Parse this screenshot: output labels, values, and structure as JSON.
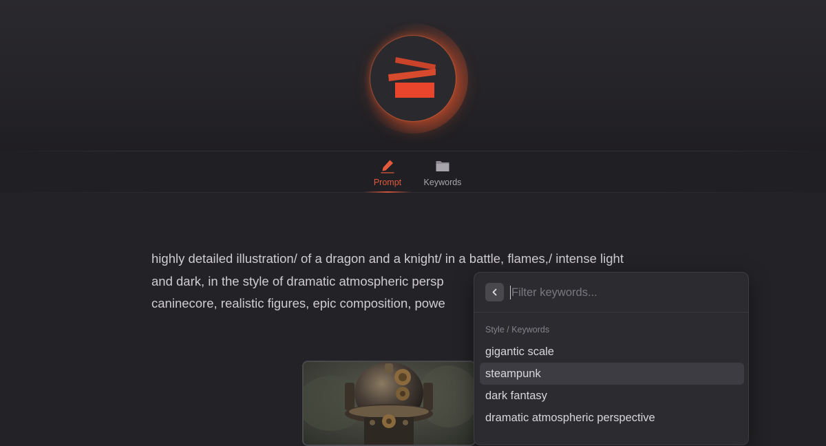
{
  "header": {
    "logo_icon": "stacked-bars-logo-icon",
    "accent_color": "#e35a3c"
  },
  "tabs": [
    {
      "label": "Prompt",
      "icon": "pencil-icon",
      "active": true
    },
    {
      "label": "Keywords",
      "icon": "folder-icon",
      "active": false
    }
  ],
  "prompt": {
    "lines": [
      "highly detailed illustration/ of a dragon and a knight/ in a battle, flames,/ intense light",
      "and dark, in the style of dramatic atmospheric persp",
      "caninecore, realistic figures, epic composition, powe"
    ]
  },
  "preview_image": {
    "subject": "steampunk-robot-image"
  },
  "keyword_dropdown": {
    "back_icon": "chevron-left-icon",
    "filter_placeholder": "Filter keywords...",
    "filter_value": "",
    "section_label": "Style / Keywords",
    "items": [
      {
        "label": "gigantic scale",
        "highlighted": false
      },
      {
        "label": "steampunk",
        "highlighted": true
      },
      {
        "label": "dark fantasy",
        "highlighted": false
      },
      {
        "label": "dramatic atmospheric perspective",
        "highlighted": false
      }
    ]
  }
}
